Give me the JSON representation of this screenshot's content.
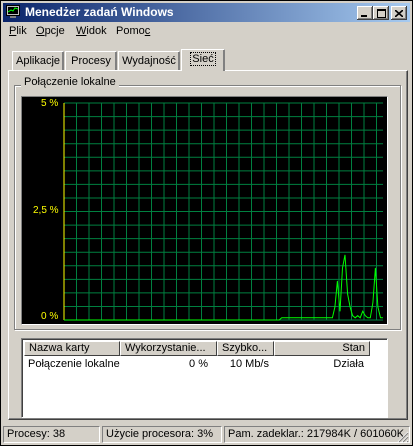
{
  "window": {
    "title": "Menedżer zadań Windows",
    "title_bg": "#0a246a",
    "face_color": "#d4d0c8"
  },
  "caption_buttons": {
    "minimize": "minimize-icon",
    "maximize": "maximize-icon",
    "close": "close-icon"
  },
  "menu": {
    "items": [
      {
        "pre": "",
        "acc": "P",
        "post": "lik"
      },
      {
        "pre": "",
        "acc": "O",
        "post": "pcje"
      },
      {
        "pre": "",
        "acc": "W",
        "post": "idok"
      },
      {
        "pre": "Pomo",
        "acc": "c",
        "post": ""
      }
    ]
  },
  "tabs": [
    {
      "label": "Aplikacje",
      "active": false
    },
    {
      "label": "Procesy",
      "active": false
    },
    {
      "label": "Wydajność",
      "active": false
    },
    {
      "label": "Sieć",
      "active": true
    }
  ],
  "graph": {
    "group_label": "Połączenie lokalne",
    "y_labels": [
      "5 %",
      "2,5 %",
      "0 %"
    ],
    "colors": {
      "grid": "#008040",
      "trace": "#00ff00",
      "background": "#000000",
      "labels": "#ffff00"
    }
  },
  "chart_data": {
    "type": "line",
    "title": "Połączenie lokalne",
    "ylim": [
      0,
      5
    ],
    "y_ticks": [
      "5 %",
      "2,5 %",
      "0 %"
    ],
    "grid": true,
    "series": [
      {
        "values": [
          0,
          0,
          0,
          0,
          0,
          0,
          0,
          0,
          0,
          0,
          0,
          0,
          0,
          0,
          0,
          0,
          0,
          0,
          0,
          0,
          0,
          0,
          0,
          0,
          0,
          0,
          0,
          0,
          0,
          0,
          0,
          0,
          0,
          0,
          0,
          0,
          0,
          0,
          0,
          0,
          0,
          0,
          0,
          0,
          0,
          0,
          0,
          0,
          0,
          0,
          0,
          0,
          0,
          0,
          0,
          0,
          0,
          0,
          0,
          0,
          0,
          0,
          0,
          0,
          0,
          0,
          0,
          0,
          0,
          0,
          0,
          0,
          0,
          0,
          0,
          0,
          0,
          0,
          0,
          0,
          0,
          0,
          0,
          0,
          0,
          0,
          0.05,
          0.05,
          0.05,
          0.05,
          0.05,
          0.05,
          0.05,
          0.05,
          0.05,
          0.05,
          0.05,
          0.05,
          0.05,
          0.05,
          0.05,
          0.05,
          0.05,
          0.05,
          0.05,
          0.05,
          0.05,
          0.3,
          0.9,
          0.2,
          1.2,
          1.5,
          0.6,
          0.3,
          0.1,
          0.05,
          0.1,
          0.05,
          0.2,
          0.1,
          0.05,
          0.05,
          0.4,
          1.2,
          0.3,
          0.05,
          0.05
        ]
      }
    ]
  },
  "table": {
    "columns": [
      "Nazwa karty",
      "Wykorzystanie...",
      "Szybko...",
      "Stan"
    ],
    "rows": [
      [
        "Połączenie lokalne",
        "0 %",
        "10 Mb/s",
        "Działa"
      ]
    ]
  },
  "status": {
    "processes": "Procesy: 38",
    "cpu": "Użycie procesora: 3%",
    "memory": "Pam. zadeklar.: 217984K / 601060K"
  }
}
